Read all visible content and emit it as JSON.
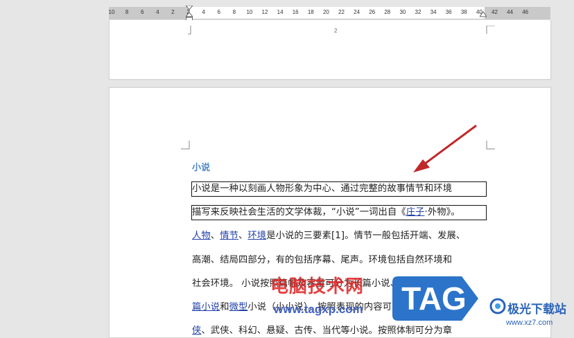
{
  "ruler": {
    "ticks": [
      "10",
      "8",
      "6",
      "4",
      "2",
      "2",
      "4",
      "6",
      "8",
      "10",
      "12",
      "14",
      "16",
      "18",
      "20",
      "22",
      "24",
      "26",
      "28",
      "30",
      "32",
      "34",
      "36",
      "38",
      "40",
      "42",
      "44",
      "46"
    ]
  },
  "page1": {
    "page_number": "2"
  },
  "document": {
    "title": "小说",
    "lines": [
      {
        "segments": [
          {
            "t": "小说是一种以刻画人物形象为中心、通过完整的故事情节和环境"
          }
        ]
      },
      {
        "segments": [
          {
            "t": "描写来反映社会生活的文学体裁，“小说”一词出自《"
          },
          {
            "t": "庄子",
            "link": true
          },
          {
            "t": "·外物》。"
          }
        ]
      },
      {
        "segments": [
          {
            "t": "人物",
            "link": true
          },
          {
            "t": "、"
          },
          {
            "t": "情节",
            "link": true
          },
          {
            "t": "、"
          },
          {
            "t": "环境",
            "link": true
          },
          {
            "t": "是小说的三要素[1]。情节一般包括开端、发展、"
          }
        ]
      },
      {
        "segments": [
          {
            "t": "高潮、结局四部分，有的包括序幕、尾声。环境包括自然环境和"
          }
        ]
      },
      {
        "segments": [
          {
            "t": "社会环境。 小说按照篇幅及容量可分为长篇小说、中篇小说、"
          },
          {
            "t": "短",
            "link": true
          }
        ]
      },
      {
        "segments": [
          {
            "t": "篇小说",
            "link": true
          },
          {
            "t": "和"
          },
          {
            "t": "微型",
            "link": true
          },
          {
            "t": "小说（小小说）。按照表现的内容可分为神话、"
          },
          {
            "t": "仙",
            "link": true
          }
        ]
      },
      {
        "segments": [
          {
            "t": "侠",
            "link": true
          },
          {
            "t": "、武侠、科幻、悬疑、古传、当代等小说。按照体制可分为章"
          }
        ]
      }
    ]
  },
  "watermarks": {
    "site_name": "电脑技术网",
    "site_url": "www.tagxp.com",
    "logo_text": "TAG",
    "jg_name": "极光下载站",
    "jg_url": "www.xz7.com"
  },
  "colors": {
    "arrow": "#c0282a",
    "title": "#4a86c5",
    "link": "#1f3fa8",
    "tag_bg": "#2b74c9"
  }
}
